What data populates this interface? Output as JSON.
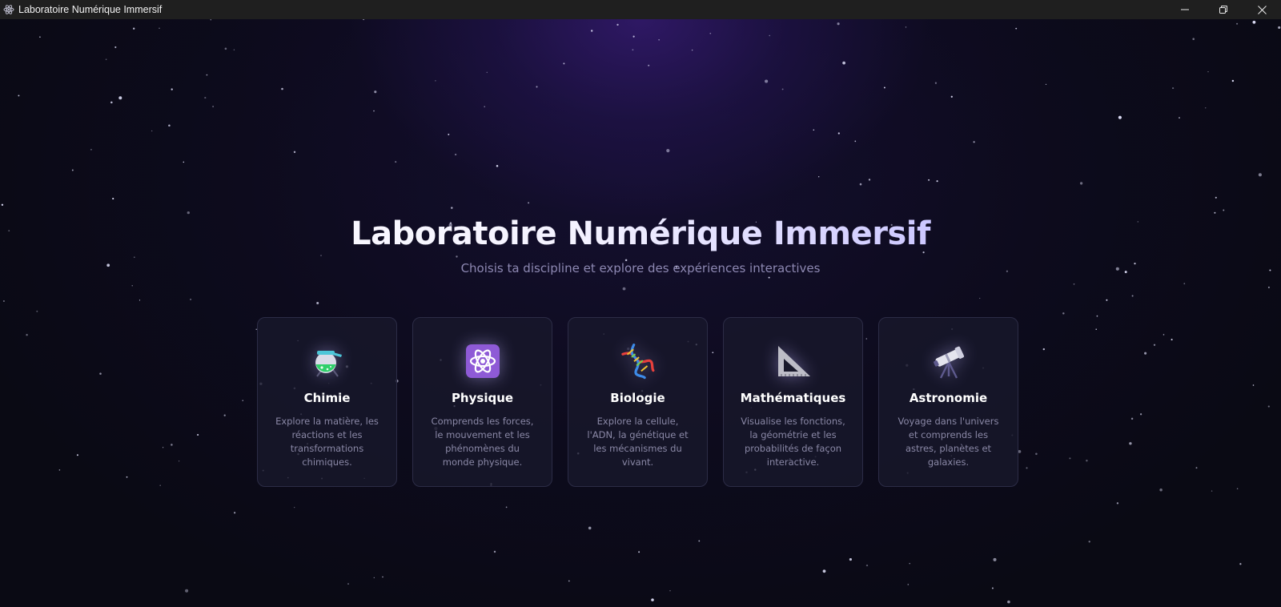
{
  "window": {
    "title": "Laboratoire Numérique Immersif"
  },
  "hero": {
    "title": "Laboratoire Numérique Immersif",
    "subtitle": "Choisis ta discipline et explore des expériences interactives"
  },
  "cards": [
    {
      "title": "Chimie",
      "description": "Explore la matière, les réactions et les transformations chimiques.",
      "icon": "flask-icon"
    },
    {
      "title": "Physique",
      "description": "Comprends les forces, le mouvement et les phénomènes du monde physique.",
      "icon": "atom-icon"
    },
    {
      "title": "Biologie",
      "description": "Explore la cellule, l'ADN, la génétique et les mécanismes du vivant.",
      "icon": "dna-icon"
    },
    {
      "title": "Mathématiques",
      "description": "Visualise les fonctions, la géométrie et les probabilités de façon interactive.",
      "icon": "set-square-icon"
    },
    {
      "title": "Astronomie",
      "description": "Voyage dans l'univers et comprends les astres, planètes et galaxies.",
      "icon": "telescope-icon"
    }
  ],
  "colors": {
    "background": "#0b0b16",
    "card_background": "#18182c",
    "card_border": "#2c2c46",
    "title_accent": "#b7b3ff",
    "subtitle": "#8d88b2",
    "card_text": "#8a88a6"
  }
}
